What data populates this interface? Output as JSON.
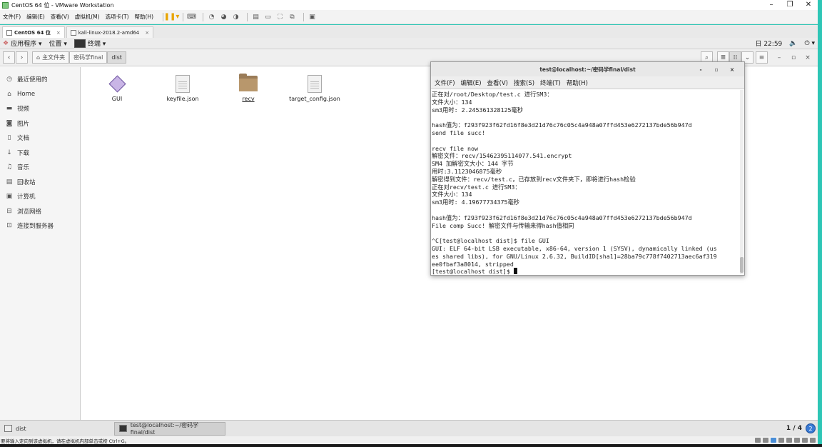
{
  "vm": {
    "title": "CentOS 64 位 - VMware Workstation",
    "menu": [
      "文件(F)",
      "编辑(E)",
      "查看(V)",
      "虚拟机(M)",
      "选项卡(T)",
      "帮助(H)"
    ],
    "tabs": [
      {
        "label": "CentOS 64 位",
        "active": true
      },
      {
        "label": "kali-linux-2018.2-amd64",
        "active": false
      }
    ],
    "status_message": "要将输入定向到该虚拟机，请在虚拟机内部单击或按 Ctrl+G。"
  },
  "guest_topbar": {
    "applications": "应用程序 ▾",
    "places": "位置 ▾",
    "terminal": "终端 ▾",
    "clock": "日 22:59",
    "volume_icon": "🔈",
    "power_icon": "⏻ ▾"
  },
  "file_manager": {
    "breadcrumbs": [
      "主文件夹",
      "密码学final",
      "dist"
    ],
    "sidebar": [
      {
        "icon": "clock-icon",
        "glyph": "◷",
        "label": "最近使用的"
      },
      {
        "icon": "home-icon",
        "glyph": "⌂",
        "label": "Home"
      },
      {
        "icon": "video-icon",
        "glyph": "▬",
        "label": "视频"
      },
      {
        "icon": "camera-icon",
        "glyph": "◙",
        "label": "图片"
      },
      {
        "icon": "document-icon",
        "glyph": "▯",
        "label": "文档"
      },
      {
        "icon": "download-icon",
        "glyph": "↓",
        "label": "下载"
      },
      {
        "icon": "music-icon",
        "glyph": "♫",
        "label": "音乐"
      },
      {
        "icon": "trash-icon",
        "glyph": "▤",
        "label": "回收站"
      },
      {
        "icon": "computer-icon",
        "glyph": "▣",
        "label": "计算机"
      },
      {
        "icon": "network-icon",
        "glyph": "⊟",
        "label": "浏览网络"
      },
      {
        "icon": "server-icon",
        "glyph": "⊡",
        "label": "连接到服务器"
      }
    ],
    "files": [
      {
        "name": "GUI",
        "kind": "executable"
      },
      {
        "name": "keyfile.json",
        "kind": "document"
      },
      {
        "name": "recv",
        "kind": "folder"
      },
      {
        "name": "target_config.json",
        "kind": "document"
      }
    ]
  },
  "terminal": {
    "title": "test@localhost:~/密码学final/dist",
    "menu": [
      "文件(F)",
      "编辑(E)",
      "查看(V)",
      "搜索(S)",
      "终端(T)",
      "帮助(H)"
    ],
    "lines": [
      "正在对/root/Desktop/test.c 进行SM3：",
      "文件大小：134",
      "sm3用时: 2.245361328125毫秒",
      "",
      "hash值为：f293f923f62fd16f8e3d21d76c76c05c4a948a07ffd453e6272137bde56b947d",
      "send file succ!",
      "",
      "recv file now",
      "解密文件：recv/15462395114077.541.encrypt",
      "SM4 加解密文大小：144 字节",
      "用时:3.1123046875毫秒",
      "解密得到文件：recv/test.c，已存放到recv文件夹下，即将进行hash检验",
      "正在对recv/test.c 进行SM3：",
      "文件大小：134",
      "sm3用时: 4.19677734375毫秒",
      "",
      "hash值为：f293f923f62fd16f8e3d21d76c76c05c4a948a07ffd453e6272137bde56b947d",
      "File comp Succ! 解密文件与传输来得hash值相同",
      "",
      "^C[test@localhost dist]$ file GUI",
      "GUI: ELF 64-bit LSB executable, x86-64, version 1 (SYSV), dynamically linked (us",
      "es shared libs), for GNU/Linux 2.6.32, BuildID[sha1]=28ba79c778f7402713aec6af319",
      "ee0fbaf3a8014, stripped"
    ],
    "prompt": "[test@localhost dist]$ "
  },
  "taskbar": {
    "items": [
      "dist",
      "test@localhost:~/密码学final/dist"
    ],
    "workspace": "1 / 4",
    "workspace_badge": "2"
  },
  "colors": {
    "desktop_teal": "#2ec6b6",
    "pause_orange": "#e8a400"
  }
}
